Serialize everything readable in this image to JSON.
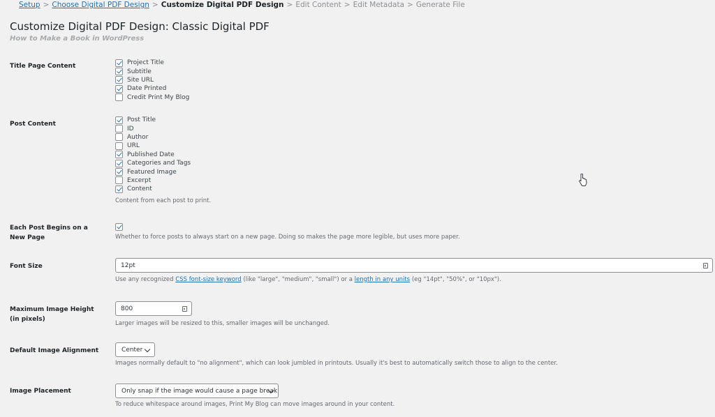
{
  "breadcrumb": {
    "items": [
      {
        "label": "Setup",
        "link": true
      },
      {
        "label": "Choose Digital PDF Design",
        "link": true
      },
      {
        "label": "Customize Digital PDF Design",
        "current": true
      },
      {
        "label": "Edit Content"
      },
      {
        "label": "Edit Metadata"
      },
      {
        "label": "Generate File"
      }
    ],
    "separator": ">"
  },
  "page": {
    "title": "Customize Digital PDF Design: Classic Digital PDF",
    "subtitle": "How to Make a Book in WordPress"
  },
  "title_page_content": {
    "label": "Title Page Content",
    "options": [
      {
        "label": "Project Title",
        "checked": true
      },
      {
        "label": "Subtitle",
        "checked": true
      },
      {
        "label": "Site URL",
        "checked": true
      },
      {
        "label": "Date Printed",
        "checked": true
      },
      {
        "label": "Credit Print My Blog",
        "checked": false
      }
    ]
  },
  "post_content": {
    "label": "Post Content",
    "options": [
      {
        "label": "Post Title",
        "checked": true
      },
      {
        "label": "ID",
        "checked": false
      },
      {
        "label": "Author",
        "checked": false
      },
      {
        "label": "URL",
        "checked": false
      },
      {
        "label": "Published Date",
        "checked": true
      },
      {
        "label": "Categories and Tags",
        "checked": true
      },
      {
        "label": "Featured Image",
        "checked": true
      },
      {
        "label": "Excerpt",
        "checked": false
      },
      {
        "label": "Content",
        "checked": true
      }
    ],
    "description": "Content from each post to print."
  },
  "new_page": {
    "label": "Each Post Begins on a New Page",
    "checked": true,
    "description": "Whether to force posts to always start on a new page. Doing so makes the page more legible, but uses more paper."
  },
  "font_size": {
    "label": "Font Size",
    "value": "12pt",
    "desc_before": "Use any recognized ",
    "link1": "CSS font-size keyword",
    "desc_middle": " (like \"large\", \"medium\", \"small\") or a ",
    "link2": "length in any units",
    "desc_after": " (eg \"14pt\", \"50%\", or \"10px\")."
  },
  "max_image_height": {
    "label": "Maximum Image Height (in pixels)",
    "value": "800",
    "description": "Larger images will be resized to this, smaller images will be unchanged."
  },
  "image_alignment": {
    "label": "Default Image Alignment",
    "value": "Center",
    "description": "Images normally default to \"no alignment\", which can look jumbled in printouts. Usually it's best to automatically switch those to align to the center."
  },
  "image_placement": {
    "label": "Image Placement",
    "value": "Only snap if the image would cause a page break",
    "description": "To reduce whitespace around images, Print My Blog can move images around in your content."
  },
  "colors": {
    "link": "#2271b1",
    "checkmark": "#2271b1",
    "background": "#f1f1f1"
  },
  "icons": {
    "cursor": "hand-pointer-icon",
    "checkbox": "checkmark-icon"
  }
}
